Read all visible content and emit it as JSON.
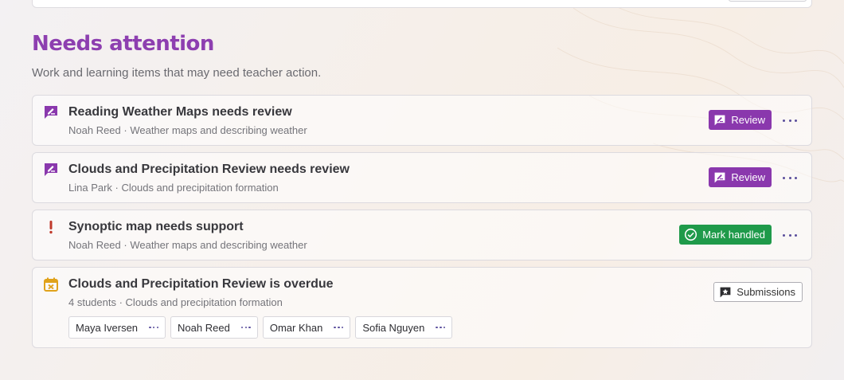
{
  "section": {
    "title": "Needs attention",
    "subtitle": "Work and learning items that may need teacher action."
  },
  "items": [
    {
      "title": "Reading Weather Maps needs review",
      "meta": "Noah Reed · Weather maps and describing weather",
      "icon": "review-icon",
      "action_label": "Review"
    },
    {
      "title": "Clouds and Precipitation Review needs review",
      "meta": "Lina Park · Clouds and precipitation formation",
      "icon": "review-icon",
      "action_label": "Review"
    },
    {
      "title": "Synoptic map needs support",
      "meta": "Noah Reed · Weather maps and describing weather",
      "icon": "exclamation-icon",
      "action_label": "Mark handled"
    },
    {
      "title": "Clouds and Precipitation Review is overdue",
      "meta": "4 students · Clouds and precipitation formation",
      "icon": "calendar-overdue-icon",
      "action_label": "Submissions",
      "students": [
        "Maya Iversen",
        "Noah Reed",
        "Omar Khan",
        "Sofia Nguyen"
      ]
    }
  ],
  "colors": {
    "accent": "#8a38ad",
    "title": "#8d3fb0",
    "success": "#1f9a4a",
    "alert": "#c0392b",
    "warning": "#e0a21b"
  }
}
